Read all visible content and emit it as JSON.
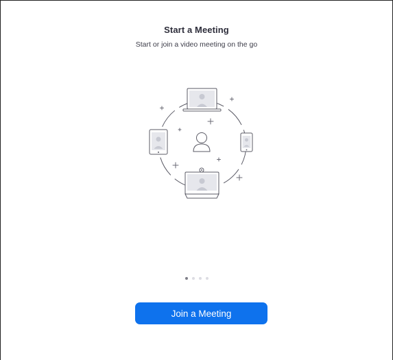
{
  "onboarding": {
    "title": "Start a Meeting",
    "subtitle": "Start or join a video meeting on the go",
    "illustration_icon": "video-meeting-devices-illustration",
    "pager": {
      "total": 4,
      "active": 1
    },
    "join_button_label": "Join a Meeting"
  },
  "colors": {
    "accent": "#0e72ed",
    "title_text": "#2d2d3a",
    "body_text": "#3c3c48",
    "illustration_line": "#5b5b66",
    "illustration_fill": "#e6e7ec",
    "dot_active": "#7e7e88",
    "dot_inactive": "#dcdce2"
  }
}
